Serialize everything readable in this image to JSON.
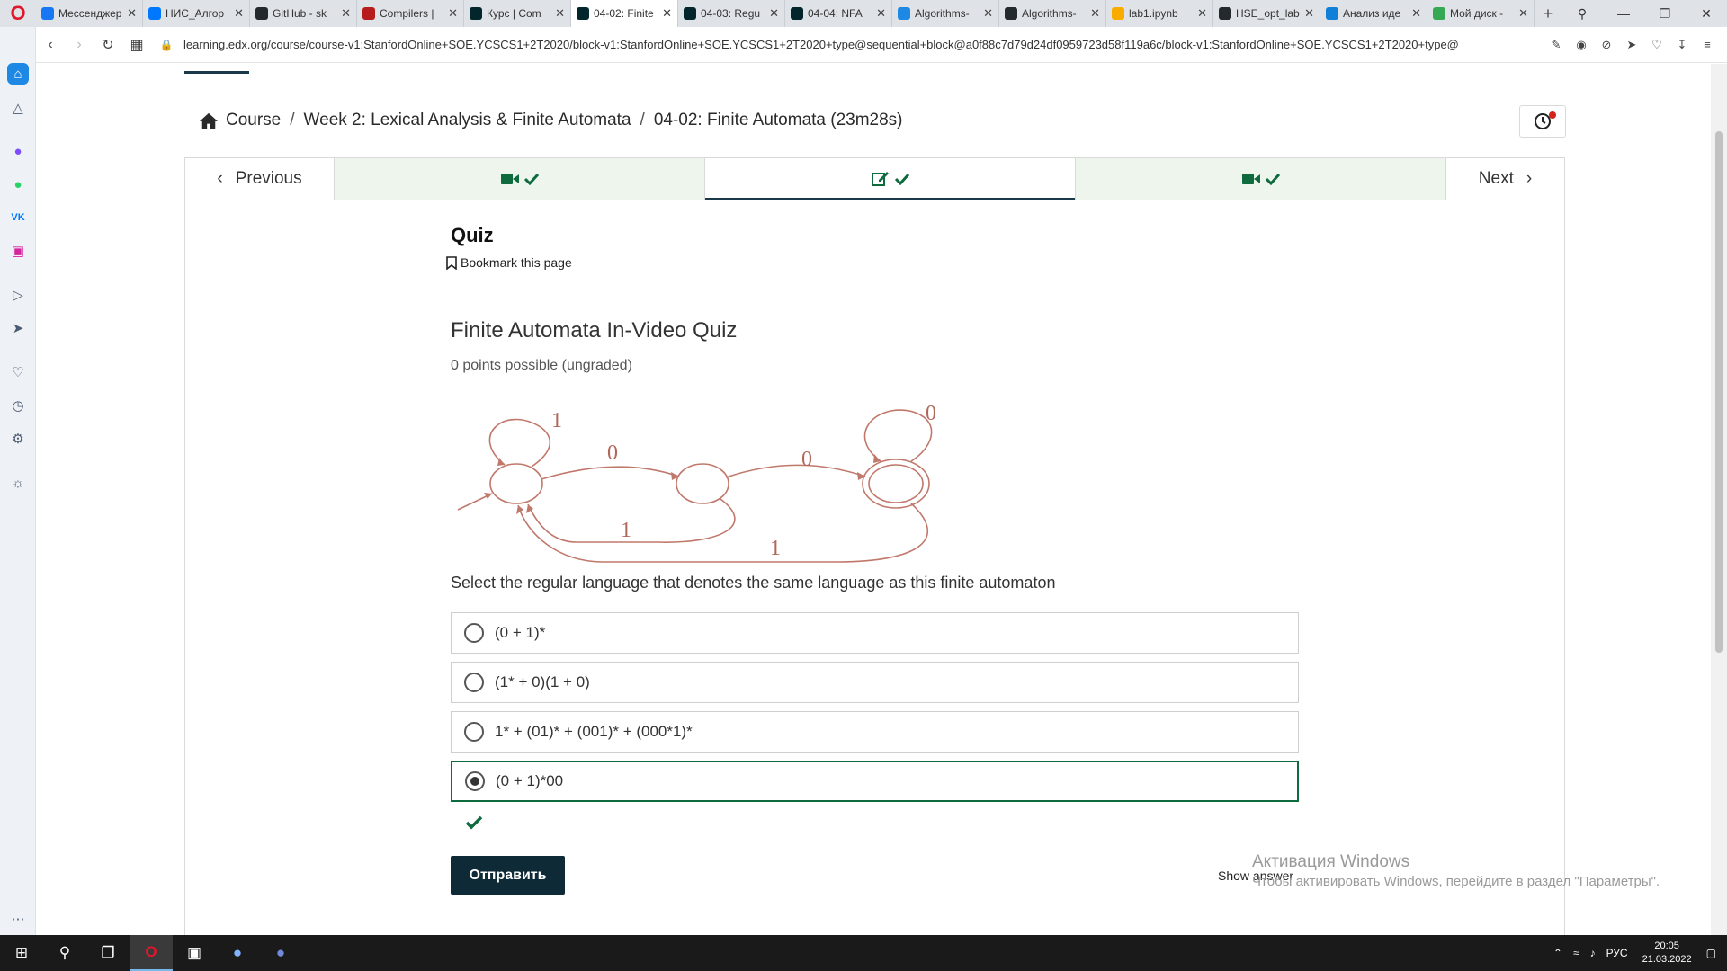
{
  "browser": {
    "tabs": [
      {
        "title": "Мессенджер",
        "icon": "messenger-icon",
        "color": "#1877f2"
      },
      {
        "title": "НИС_Алгор",
        "icon": "vk-icon",
        "color": "#0077ff"
      },
      {
        "title": "GitHub - sk",
        "icon": "github-icon",
        "color": "#24292e"
      },
      {
        "title": "Compilers |",
        "icon": "course-icon",
        "color": "#b71c1c"
      },
      {
        "title": "Курс | Com",
        "icon": "edx-icon",
        "color": "#02262b"
      },
      {
        "title": "04-02: Finite",
        "icon": "edx-icon",
        "color": "#02262b",
        "active": true
      },
      {
        "title": "04-03: Regu",
        "icon": "edx-icon",
        "color": "#02262b"
      },
      {
        "title": "04-04: NFA",
        "icon": "edx-icon",
        "color": "#02262b"
      },
      {
        "title": "Algorithms-",
        "icon": "algorithms-icon",
        "color": "#1e88e5"
      },
      {
        "title": "Algorithms-",
        "icon": "github-icon",
        "color": "#24292e"
      },
      {
        "title": "lab1.ipynb",
        "icon": "colab-icon",
        "color": "#f9ab00"
      },
      {
        "title": "HSE_opt_lab",
        "icon": "github-icon",
        "color": "#24292e"
      },
      {
        "title": "Анализ иде",
        "icon": "edge-icon",
        "color": "#0f7fd8"
      },
      {
        "title": "Мой диск -",
        "icon": "drive-icon",
        "color": "#34a853"
      }
    ],
    "url": "learning.edx.org/course/course-v1:StanfordOnline+SOE.YCSCS1+2T2020/block-v1:StanfordOnline+SOE.YCSCS1+2T2020+type@sequential+block@a0f88c7d79d24df0959723d58f119a6c/block-v1:StanfordOnline+SOE.YCSCS1+2T2020+type@"
  },
  "breadcrumb": {
    "course": "Course",
    "section": "Week 2: Lexical Analysis & Finite Automata",
    "unit": "04-02: Finite Automata (23m28s)"
  },
  "sequence_nav": {
    "previous": "Previous",
    "next": "Next",
    "units": [
      {
        "type": "video-icon",
        "completed": true
      },
      {
        "type": "problem-icon",
        "completed": true,
        "active": true
      },
      {
        "type": "video-icon",
        "completed": true
      }
    ]
  },
  "unit": {
    "title": "Quiz",
    "bookmark_label": "Bookmark this page"
  },
  "problem": {
    "title": "Finite Automata In-Video Quiz",
    "points": "0 points possible (ungraded)",
    "question": "Select the regular language that denotes the same language as this finite automaton",
    "choices": [
      {
        "label": "(0 + 1)*",
        "selected": false
      },
      {
        "label": "(1* + 0)(1 + 0)",
        "selected": false
      },
      {
        "label": "1* + (01)* + (001)* + (000*1)*",
        "selected": false
      },
      {
        "label": "(0 + 1)*00",
        "selected": true
      }
    ],
    "result": "correct",
    "submit_label": "Отправить",
    "show_answer_label": "Show answer"
  },
  "automaton": {
    "edge_labels": {
      "loop_start": "1",
      "start_to_middle": "0",
      "middle_to_accept": "0",
      "loop_accept": "0",
      "middle_to_start": "1",
      "accept_to_start": "1"
    },
    "stroke_color": "#c0786b"
  },
  "watermark": {
    "title": "Активация Windows",
    "subtitle": "Чтобы активировать Windows, перейдите в раздел \"Параметры\"."
  },
  "taskbar": {
    "language": "РУС",
    "time": "20:05",
    "date": "21.03.2022"
  },
  "colors": {
    "accent_green": "#0d6b3e",
    "submit_bg": "#0e2a36",
    "visited_unit_bg": "#eef5ec"
  }
}
